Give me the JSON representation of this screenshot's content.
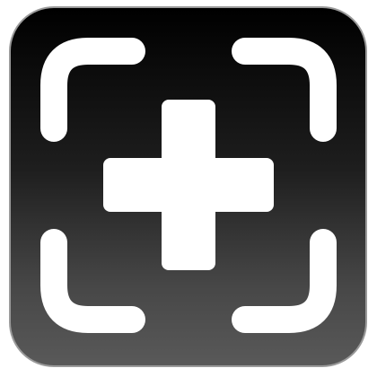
{
  "icon": {
    "symbol": "add-capture-icon",
    "glyph": "plus-icon",
    "frame": "viewfinder-corners",
    "colors": {
      "background_top": "#000000",
      "background_bottom": "#595959",
      "border": "#9a9a9a",
      "foreground": "#ffffff"
    }
  }
}
